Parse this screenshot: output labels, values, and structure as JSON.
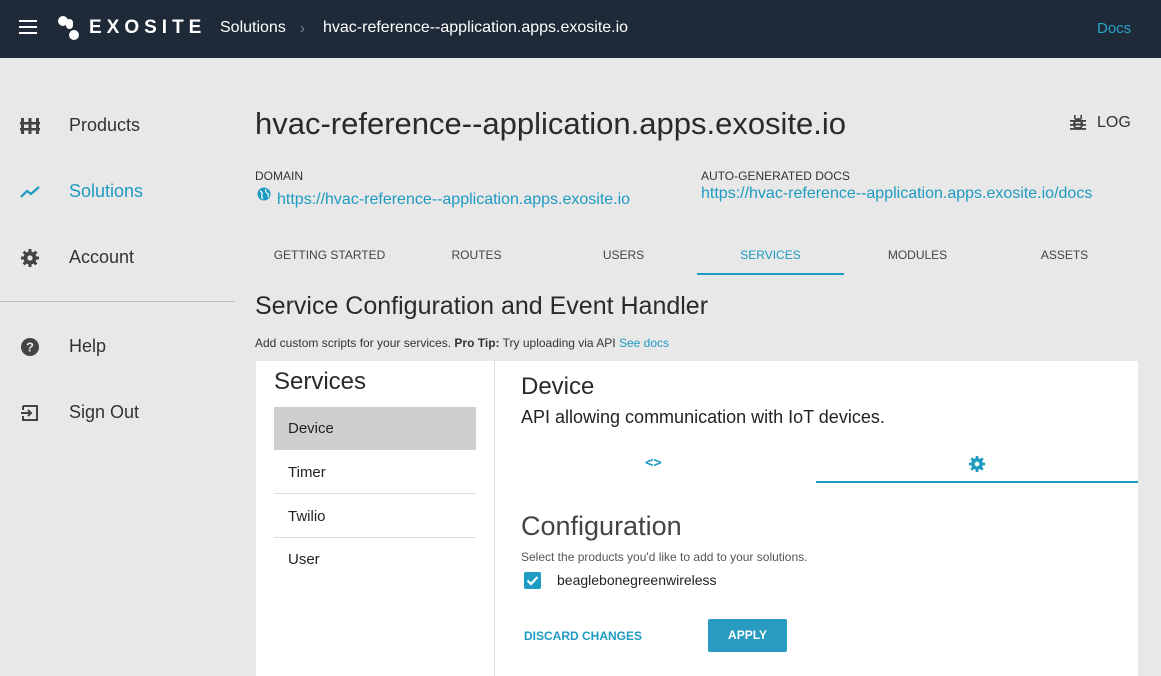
{
  "topbar": {
    "brand": "EXOSITE",
    "breadcrumb": [
      "Solutions",
      "hvac-reference--application.apps.exosite.io"
    ],
    "separator": "›",
    "docs": "Docs"
  },
  "sidebar": {
    "items": [
      {
        "label": "Products",
        "icon": "products-icon"
      },
      {
        "label": "Solutions",
        "icon": "solutions-icon",
        "active": true
      },
      {
        "label": "Account",
        "icon": "gear-icon"
      },
      {
        "label": "Help",
        "icon": "help-icon"
      },
      {
        "label": "Sign Out",
        "icon": "sign-out-icon"
      }
    ]
  },
  "header": {
    "title": "hvac-reference--application.apps.exosite.io",
    "log": "LOG",
    "domain_label": "DOMAIN",
    "domain_url": "https://hvac-reference--application.apps.exosite.io",
    "docs_label": "AUTO-GENERATED DOCS",
    "docs_url": "https://hvac-reference--application.apps.exosite.io/docs"
  },
  "tabs": [
    {
      "label": "GETTING STARTED"
    },
    {
      "label": "ROUTES"
    },
    {
      "label": "USERS"
    },
    {
      "label": "SERVICES",
      "active": true
    },
    {
      "label": "MODULES"
    },
    {
      "label": "ASSETS"
    }
  ],
  "section": {
    "title": "Service Configuration and Event Handler",
    "sub_prefix": "Add custom scripts for your services.",
    "protip": "Pro Tip:",
    "sub_middle": "Try uploading via API",
    "see_docs": "See docs"
  },
  "services": {
    "title": "Services",
    "items": [
      "Device",
      "Timer",
      "Twilio",
      "User"
    ],
    "selected": "Device"
  },
  "detail": {
    "title": "Device",
    "description": "API allowing communication with IoT devices.",
    "code_tab_icon": "<>",
    "config_title": "Configuration",
    "config_sub": "Select the products you'd like to add to your solutions.",
    "product": "beaglebonegreenwireless",
    "product_checked": true,
    "discard": "DISCARD CHANGES",
    "apply": "APPLY"
  },
  "colors": {
    "accent": "#1e9bc2",
    "topbar": "#1f2a38",
    "background": "#e8e8e8"
  }
}
